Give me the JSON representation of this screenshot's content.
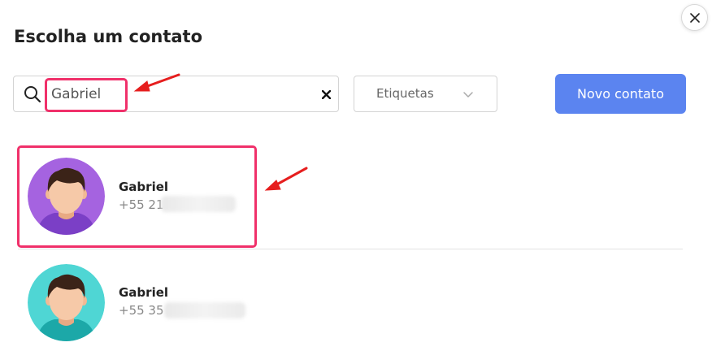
{
  "dialog": {
    "title": "Escolha um contato",
    "close_icon": "close-icon"
  },
  "search": {
    "value": "Gabriel",
    "placeholder": "",
    "icon": "search-icon",
    "clear_icon": "close-icon"
  },
  "tags_filter": {
    "label": "Etiquetas",
    "icon": "chevron-down-icon"
  },
  "new_contact_button": {
    "label": "Novo contato",
    "color": "#5b84f0"
  },
  "contacts": [
    {
      "name": "Gabriel",
      "phone_visible": "+55 21",
      "avatar_color": "#a563e0",
      "shirt_color": "#7b3fc6"
    },
    {
      "name": "Gabriel",
      "phone_visible": "+55 35",
      "avatar_color": "#4fd6d4",
      "shirt_color": "#1ca8a8"
    }
  ],
  "annotations": {
    "highlight_color": "#f0306a",
    "arrow_color": "#e61e1e"
  }
}
